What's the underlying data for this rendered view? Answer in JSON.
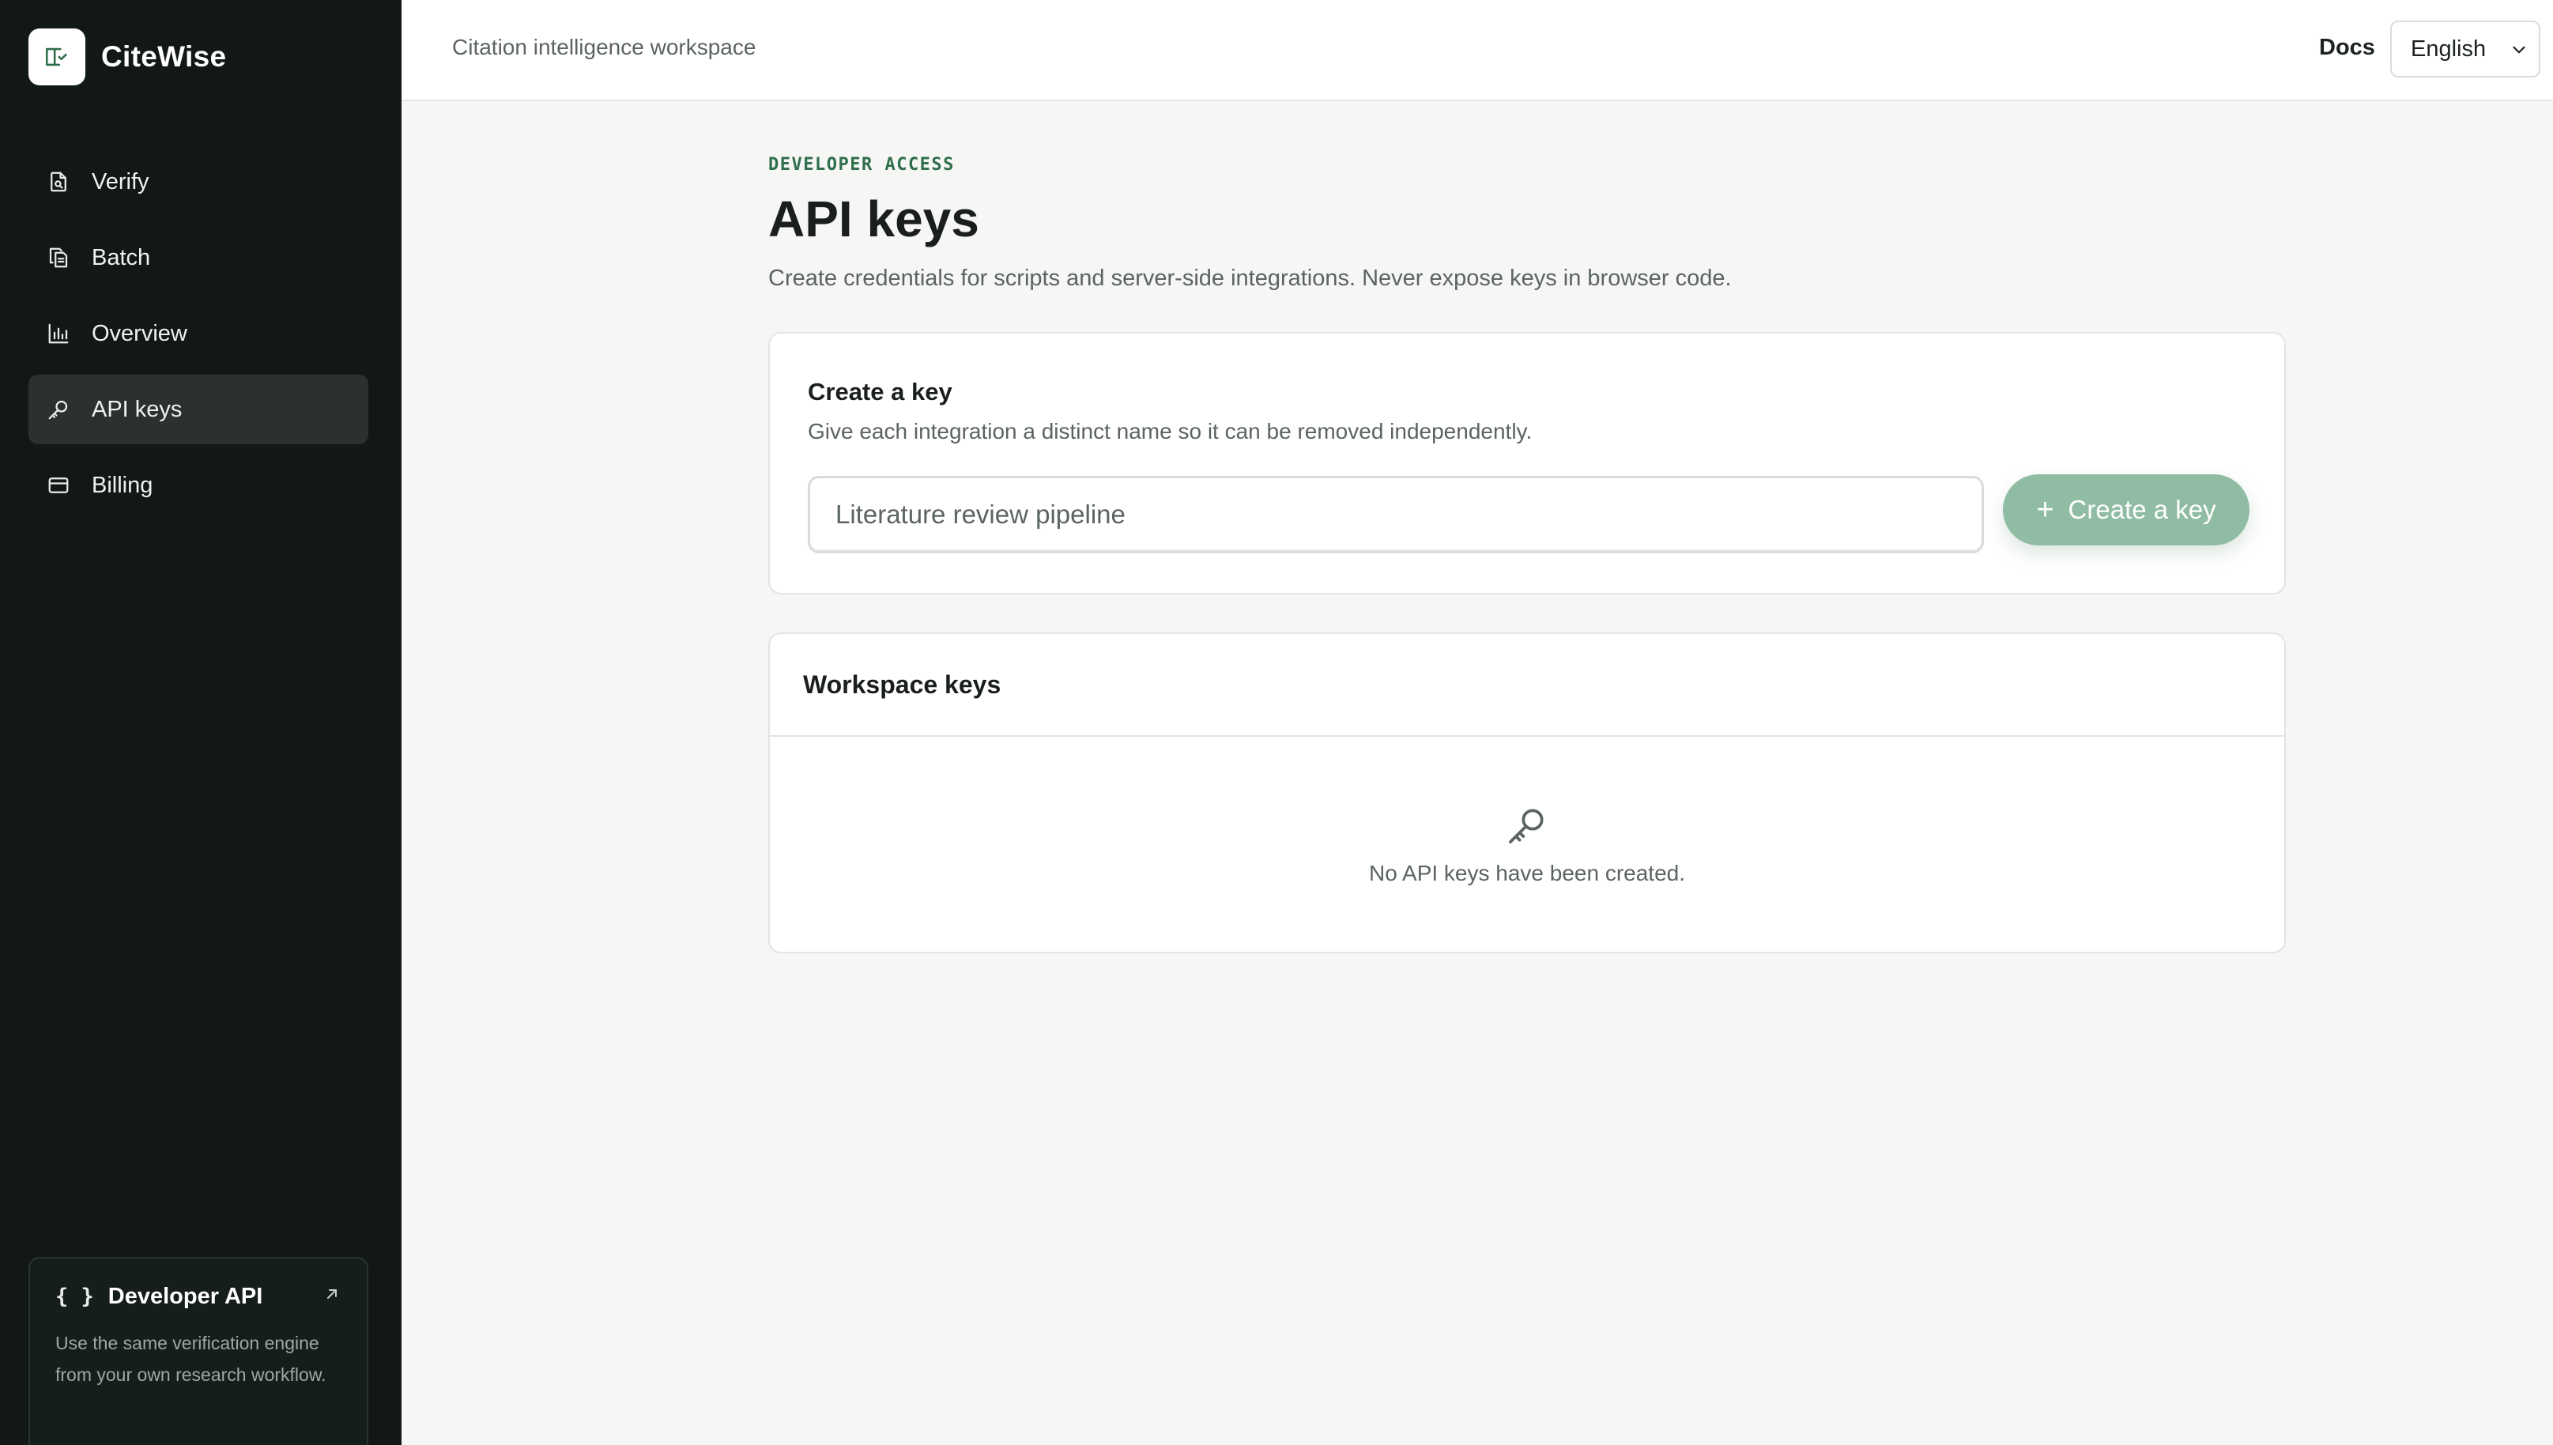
{
  "app": {
    "name": "CiteWise",
    "logo_icon": "book-check-icon"
  },
  "sidebar": {
    "items": [
      {
        "label": "Verify",
        "icon": "file-search-icon",
        "active": false
      },
      {
        "label": "Batch",
        "icon": "files-copy-icon",
        "active": false
      },
      {
        "label": "Overview",
        "icon": "bar-chart-icon",
        "active": false
      },
      {
        "label": "API keys",
        "icon": "key-icon",
        "active": true
      },
      {
        "label": "Billing",
        "icon": "credit-card-icon",
        "active": false
      }
    ],
    "developer_card": {
      "braces": "{ }",
      "title": "Developer API",
      "description": "Use the same verification engine from your own research workflow."
    }
  },
  "topbar": {
    "workspace_label": "Citation intelligence workspace",
    "docs_label": "Docs",
    "language": {
      "selected": "English"
    }
  },
  "page": {
    "eyebrow": "DEVELOPER ACCESS",
    "title": "API keys",
    "subtitle": "Create credentials for scripts and server-side integrations. Never expose keys in browser code."
  },
  "create_card": {
    "title": "Create a key",
    "description": "Give each integration a distinct name so it can be removed independently.",
    "input_placeholder": "Literature review pipeline",
    "input_value": "",
    "button_label": "Create a key"
  },
  "keys_card": {
    "title": "Workspace keys",
    "empty_text": "No API keys have been created."
  },
  "colors": {
    "sidebar_bg": "#111815",
    "accent": "#2f6e4b",
    "button_bg": "#8fbca3",
    "page_bg": "#f6f6f4"
  }
}
